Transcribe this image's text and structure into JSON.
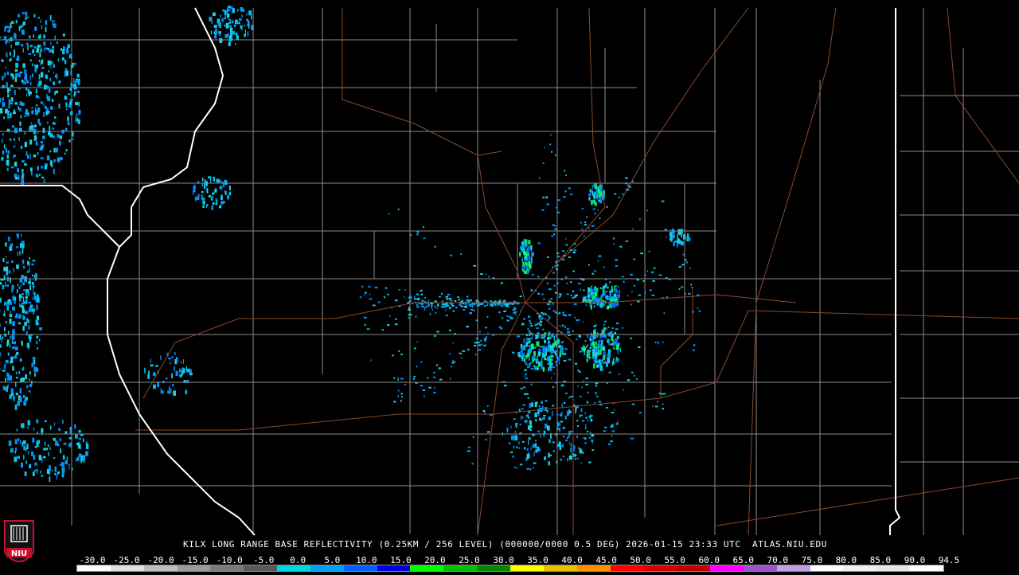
{
  "product": {
    "station": "KILX",
    "title_text": "KILX LONG RANGE BASE REFLECTIVITY (0.25KM / 256 LEVEL) (000000/0000 0.5 DEG) 2026-01-15 23:33 UTC  ATLAS.NIU.EDU"
  },
  "logo": {
    "text": "NIU",
    "brand_color": "#c8102e"
  },
  "colors": {
    "background": "#000000",
    "county_lines": "#8c8c8c",
    "state_lines": "#ffffff",
    "highways": "#8b4a2b"
  },
  "scale": {
    "labels": [
      "-30.0",
      "-25.0",
      "-20.0",
      "-15.0",
      "-10.0",
      "-5.0",
      "0.0",
      "5.0",
      "10.0",
      "15.0",
      "20.0",
      "25.0",
      "30.0",
      "35.0",
      "40.0",
      "45.0",
      "50.0",
      "55.0",
      "60.0",
      "65.0",
      "70.0",
      "75.0",
      "80.0",
      "85.0",
      "90.0",
      "94.5"
    ],
    "colors": [
      "#ffffff",
      "#e0e0e0",
      "#bdbdbd",
      "#9a9a9a",
      "#7a7a7a",
      "#5a5a5a",
      "#00d8e0",
      "#00a0f0",
      "#0060ff",
      "#0000e0",
      "#00ff00",
      "#00c000",
      "#008800",
      "#ffff00",
      "#e7c000",
      "#ff9000",
      "#ff0000",
      "#d60000",
      "#c00000",
      "#ff00ff",
      "#9955c9",
      "#c0a0e0",
      "#ffffff",
      "#f0f0f0",
      "#e8e8e8",
      "#ffffff"
    ]
  }
}
